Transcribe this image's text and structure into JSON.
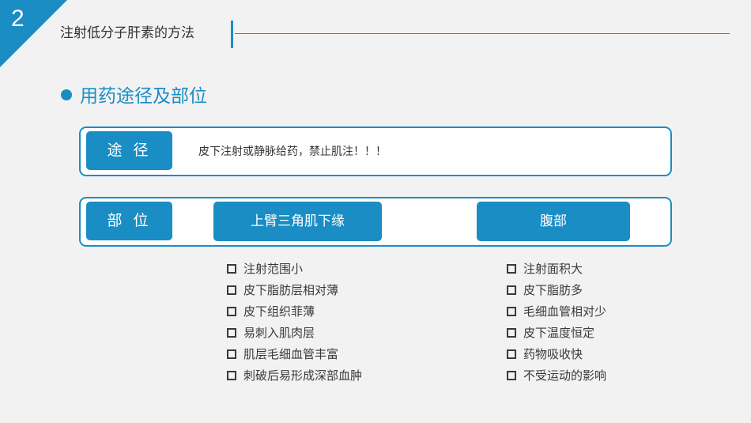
{
  "slide": {
    "number": "2",
    "title": "注射低分子肝素的方法",
    "section_heading": "用药途径及部位"
  },
  "route": {
    "label": "途 径",
    "text": "皮下注射或静脉给药，禁止肌注！！！"
  },
  "site": {
    "label": "部 位",
    "options": [
      {
        "name": "上臂三角肌下缘",
        "points": [
          "注射范围小",
          "皮下脂肪层相对薄",
          "皮下组织菲薄",
          "易刺入肌肉层",
          "肌层毛细血管丰富",
          "刺破后易形成深部血肿"
        ]
      },
      {
        "name": "腹部",
        "points": [
          "注射面积大",
          "皮下脂肪多",
          "毛细血管相对少",
          "皮下温度恒定",
          "药物吸收快",
          "不受运动的影响"
        ]
      }
    ]
  },
  "colors": {
    "accent": "#1a8dc4",
    "background": "#f2f2f2",
    "text": "#333333"
  },
  "icons": {
    "bullet": "filled-circle",
    "list_marker": "hollow-square"
  }
}
